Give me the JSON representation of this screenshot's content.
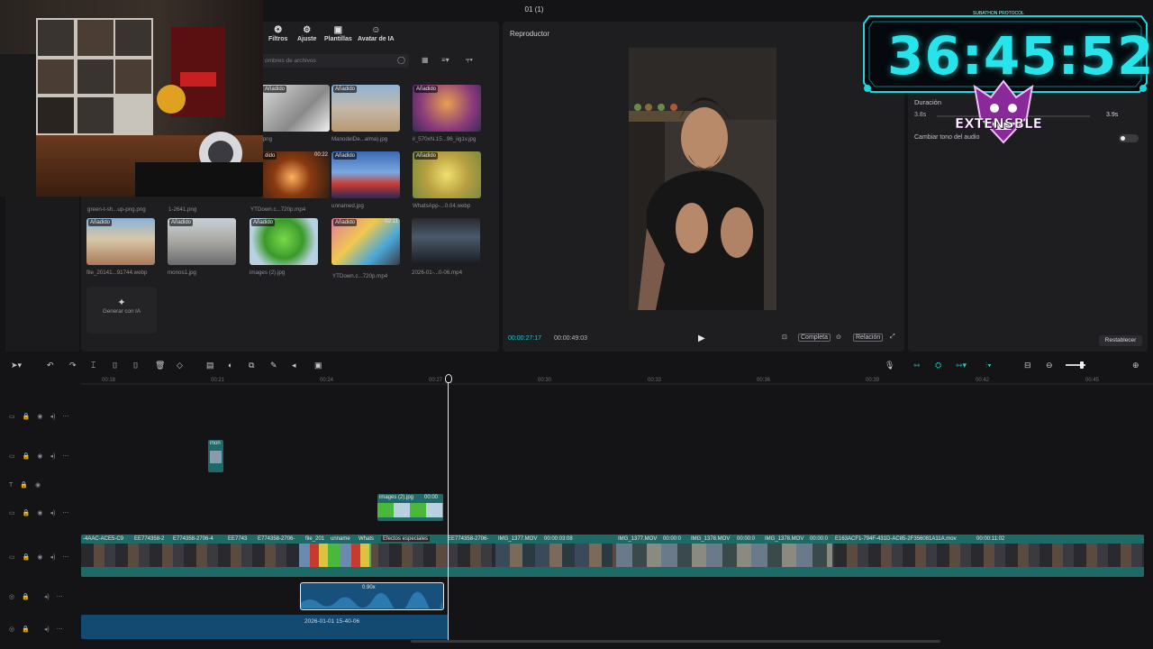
{
  "window": {
    "title": "01 (1)"
  },
  "media": {
    "tabs": [
      "Filtros",
      "Ajuste",
      "Plantillas",
      "Avatar de IA"
    ],
    "search_placeholder": "ombres de archivos",
    "items": [
      {
        "badge": "Añadido",
        "duration": "",
        "name": ".png"
      },
      {
        "badge": "Añadido",
        "duration": "",
        "name": "ManodelDe...alma).jpg"
      },
      {
        "badge": "Añadido",
        "duration": "",
        "name": "il_570xN.15...96_iig1v.jpg"
      },
      {
        "badge": "dido",
        "duration": "00:22",
        "name": "1-2641.png"
      },
      {
        "badge": "",
        "duration": "",
        "name": "YTDown.c...720p.mp4"
      },
      {
        "badge": "Añadido",
        "duration": "",
        "name": "unnamed.jpg"
      },
      {
        "badge": "Añadido",
        "duration": "",
        "name": "WhatsApp-...0.04.webp"
      },
      {
        "badge": "",
        "duration": "",
        "name": "green-t-sh...up-png.png"
      },
      {
        "badge": "Añadido",
        "duration": "",
        "name": "file_20141...91744.webp"
      },
      {
        "badge": "Añadido",
        "duration": "",
        "name": "monos1.jpg"
      },
      {
        "badge": "Añadido",
        "duration": "",
        "name": "images (2).jpg"
      },
      {
        "badge": "Añadido",
        "duration": "02:11",
        "name": "YTDown.c...720p.mp4"
      },
      {
        "badge": "",
        "duration": "",
        "name": "2026-01-...0-06.mp4"
      }
    ],
    "generate_label": "Generar con IA"
  },
  "player": {
    "title": "Reproductor",
    "current_time": "00:00:27:17",
    "total_time": "00:00:49:03",
    "full_label": "Completa",
    "ratio_label": "Relación"
  },
  "properties": {
    "duration_label": "Duración",
    "duration_min": "3.8s",
    "duration_value": "3.9s",
    "pitch_label": "Cambiar tono del audio",
    "reset_label": "Restablecer"
  },
  "overlay": {
    "timer": "36:45:52",
    "caption": "SUBATHON PROTOCOL",
    "logo": "EXTENSBLE"
  },
  "timeline": {
    "ticks": [
      "00:18",
      "00:21",
      "00:24",
      "00:27",
      "00:30",
      "00:33",
      "00:36",
      "00:39",
      "00:42",
      "00:45"
    ],
    "clips": {
      "small_overlay": "mon",
      "images_clip": "images (2).jpg",
      "images_clip_dur": "00:00",
      "main_labels": [
        "-4AAC-ACE5-C9",
        "EE774358-2",
        "E774358-2706-4",
        "EE7743",
        "E774358-2706-",
        "file_201",
        "unname",
        "Whats",
        "Efectos especiales",
        "EE774358-2706-",
        "IMG_1377.MOV",
        "00:00:03:08",
        "IMG_1377.MOV",
        "00:00:0",
        "IMG_1378.MOV",
        "00:00:0",
        "IMG_1378.MOV",
        "00:00:0",
        "E163ACF1-794F-431D-AC85-2F356081A11A.mov",
        "00:00:11:02"
      ],
      "audio_speed": "0.90x",
      "audio_long": "2026-01-01 15-40-06"
    }
  }
}
